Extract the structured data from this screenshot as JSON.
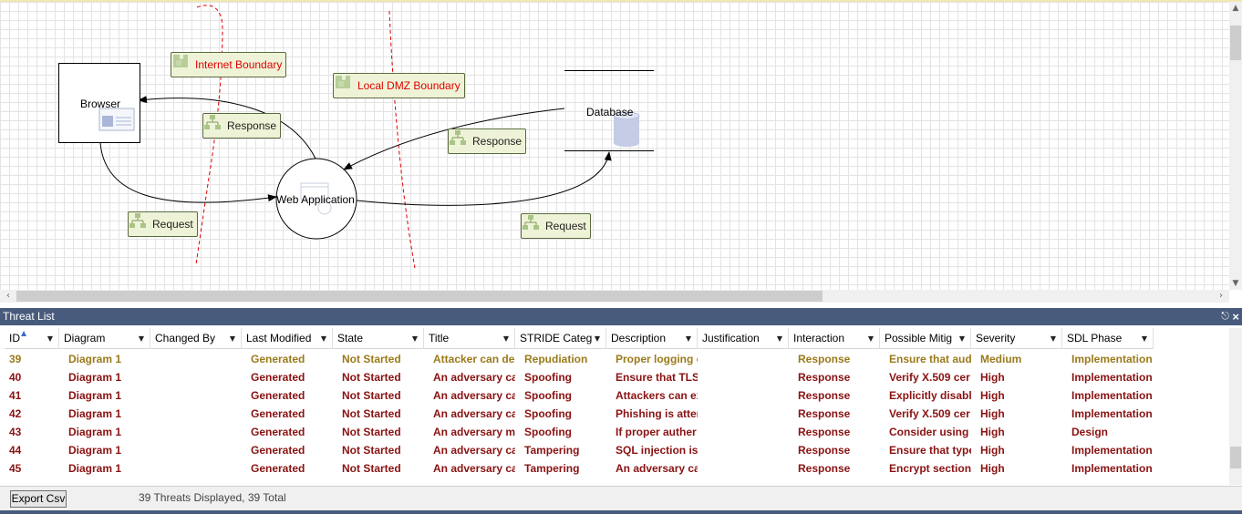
{
  "diagram": {
    "nodes": {
      "browser": "Browser",
      "web_application": "Web Application",
      "database": "Database"
    },
    "boundaries": {
      "internet": "Internet Boundary",
      "local_dmz": "Local DMZ Boundary"
    },
    "flows": {
      "response_browser": "Response",
      "response_db": "Response",
      "request_browser": "Request",
      "request_db": "Request"
    }
  },
  "threat_list": {
    "title": "Threat List",
    "pin_icon": "pin-icon",
    "close_icon": "close-icon",
    "columns": [
      "ID",
      "Diagram",
      "Changed By",
      "Last Modified",
      "State",
      "Title",
      "STRIDE Categ",
      "Description",
      "Justification",
      "Interaction",
      "Possible Mitig",
      "Severity",
      "SDL Phase"
    ],
    "rows": [
      {
        "id": "39",
        "diagram": "Diagram 1",
        "changed_by": "",
        "last_modified": "Generated",
        "state": "Not Started",
        "title": "Attacker can de",
        "stride": "Repudiation",
        "description": "Proper logging o",
        "justification": "",
        "interaction": "Response",
        "mitigation": "Ensure that audi",
        "severity": "Medium",
        "phase": "Implementation"
      },
      {
        "id": "40",
        "diagram": "Diagram 1",
        "changed_by": "",
        "last_modified": "Generated",
        "state": "Not Started",
        "title": "An adversary ca",
        "stride": "Spoofing",
        "description": "Ensure that TLS",
        "justification": "",
        "interaction": "Response",
        "mitigation": "Verify X.509 cer",
        "severity": "High",
        "phase": "Implementation"
      },
      {
        "id": "41",
        "diagram": "Diagram 1",
        "changed_by": "",
        "last_modified": "Generated",
        "state": "Not Started",
        "title": "An adversary ca",
        "stride": "Spoofing",
        "description": "Attackers can ex",
        "justification": "",
        "interaction": "Response",
        "mitigation": "Explicitly disable",
        "severity": "High",
        "phase": "Implementation"
      },
      {
        "id": "42",
        "diagram": "Diagram 1",
        "changed_by": "",
        "last_modified": "Generated",
        "state": "Not Started",
        "title": "An adversary ca",
        "stride": "Spoofing",
        "description": "Phishing is atten",
        "justification": "",
        "interaction": "Response",
        "mitigation": "Verify X.509 cer",
        "severity": "High",
        "phase": "Implementation"
      },
      {
        "id": "43",
        "diagram": "Diagram 1",
        "changed_by": "",
        "last_modified": "Generated",
        "state": "Not Started",
        "title": "An adversary ma",
        "stride": "Spoofing",
        "description": "If proper auther",
        "justification": "",
        "interaction": "Response",
        "mitigation": "Consider using a",
        "severity": "High",
        "phase": "Design"
      },
      {
        "id": "44",
        "diagram": "Diagram 1",
        "changed_by": "",
        "last_modified": "Generated",
        "state": "Not Started",
        "title": "An adversary ca",
        "stride": "Tampering",
        "description": "SQL injection is a",
        "justification": "",
        "interaction": "Response",
        "mitigation": "Ensure that type",
        "severity": "High",
        "phase": "Implementation"
      },
      {
        "id": "45",
        "diagram": "Diagram 1",
        "changed_by": "",
        "last_modified": "Generated",
        "state": "Not Started",
        "title": "An adversary ca",
        "stride": "Tampering",
        "description": "An adversary ca",
        "justification": "",
        "interaction": "Response",
        "mitigation": "Encrypt sections",
        "severity": "High",
        "phase": "Implementation"
      }
    ],
    "export_label": "Export Csv",
    "status_text": "39 Threats Displayed, 39 Total"
  }
}
